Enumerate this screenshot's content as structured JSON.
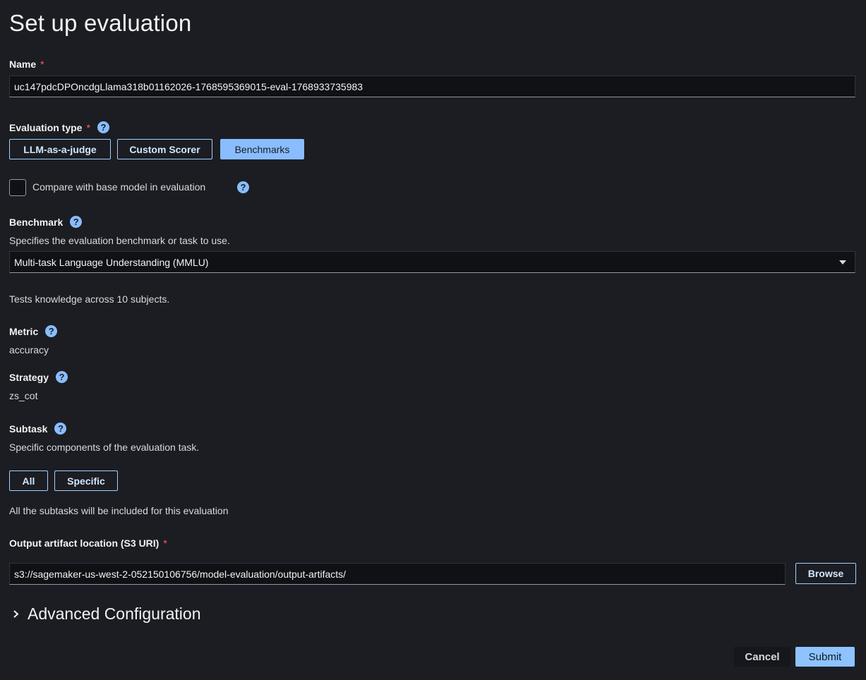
{
  "page": {
    "title": "Set up evaluation"
  },
  "name_field": {
    "label": "Name",
    "required_mark": "*",
    "value": "uc147pdcDPOncdgLlama318b01162026-1768595369015-eval-1768933735983"
  },
  "evaluation_type": {
    "label": "Evaluation type",
    "required_mark": "*",
    "help": "?",
    "options": [
      "LLM-as-a-judge",
      "Custom Scorer",
      "Benchmarks"
    ],
    "selected": "Benchmarks"
  },
  "compare": {
    "label": "Compare with base model in evaluation",
    "checked": false,
    "help": "?"
  },
  "benchmark": {
    "label": "Benchmark",
    "help": "?",
    "description": "Specifies the evaluation benchmark or task to use.",
    "selected": "Multi-task Language Understanding (MMLU)",
    "info": "Tests knowledge across 10 subjects."
  },
  "metric": {
    "label": "Metric",
    "help": "?",
    "value": "accuracy"
  },
  "strategy": {
    "label": "Strategy",
    "help": "?",
    "value": "zs_cot"
  },
  "subtask": {
    "label": "Subtask",
    "help": "?",
    "description": "Specific components of the evaluation task.",
    "options": [
      "All",
      "Specific"
    ],
    "note": "All the subtasks will be included for this evaluation"
  },
  "output": {
    "label": "Output artifact location (S3 URI)",
    "required_mark": "*",
    "value": "s3://sagemaker-us-west-2-052150106756/model-evaluation/output-artifacts/",
    "browse_label": "Browse"
  },
  "advanced": {
    "label": "Advanced Configuration",
    "icon": "chevron-right-icon"
  },
  "footer": {
    "cancel_label": "Cancel",
    "submit_label": "Submit"
  },
  "colors": {
    "background": "#1b1d22",
    "accent": "#89bdff",
    "required": "#ff5d64"
  }
}
